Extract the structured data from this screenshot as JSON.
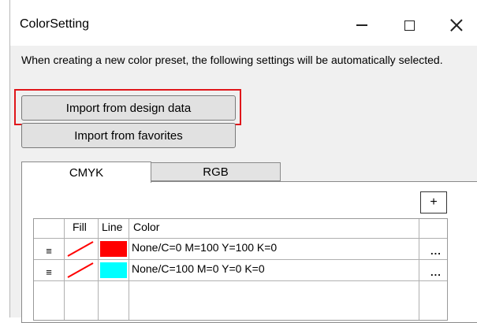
{
  "window": {
    "title": "ColorSetting",
    "controls": {
      "minimize": "—",
      "maximize": "☐",
      "close": "✕"
    }
  },
  "description": "When creating a new color preset, the following settings will be automatically selected.",
  "buttons": {
    "import_design": "Import from design data",
    "import_favorites": "Import from favorites",
    "add": "+"
  },
  "tabs": [
    {
      "label": "CMYK",
      "selected": true
    },
    {
      "label": "RGB",
      "selected": false
    }
  ],
  "table": {
    "headers": {
      "fill": "Fill",
      "line": "Line",
      "color": "Color"
    },
    "rows": [
      {
        "handle": "≡",
        "fill": "none",
        "line_color": "#ff0000",
        "color": "None/C=0 M=100 Y=100 K=0",
        "more": "..."
      },
      {
        "handle": "≡",
        "fill": "none",
        "line_color": "#00ffff",
        "color": "None/C=100 M=0 Y=0 K=0",
        "more": "..."
      }
    ]
  },
  "colors": {
    "highlight": "#e0161a",
    "no_fill_slash": "#ff0000"
  }
}
